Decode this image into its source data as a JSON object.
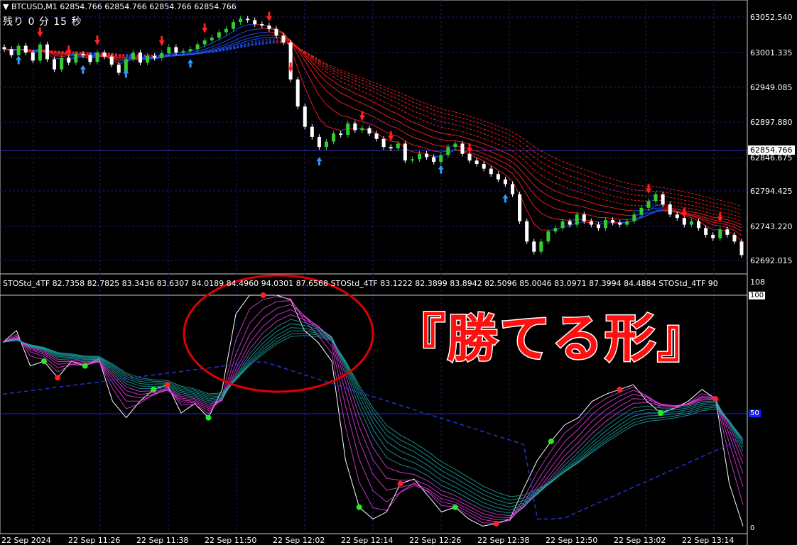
{
  "header": {
    "symbol_line": "BTCUSD,M1  62854.766 62854.766 62854.766 62854.766",
    "timer": "残り 0 分 15 秒"
  },
  "price_axis": [
    "63052.540",
    "63001.335",
    "62949.085",
    "62897.880",
    "62846.675",
    "62794.425",
    "62743.220",
    "62692.015"
  ],
  "current_price": "62854.766",
  "indicator": {
    "header": "STOStd_4TF 82.7358 82.7825 83.3436 83.6307 84.0189 84.4960 94.0301 87.6568  STOStd_4TF 83.1222 82.3899 83.8942 82.5096 85.0046 83.0971 87.3994 84.4884  STOStd_4TF 90",
    "top_label": "108",
    "level_100": "100",
    "level_50": "50",
    "level_0": "0"
  },
  "time_axis": [
    "22 Sep 2024",
    "22 Sep 11:26",
    "22 Sep 11:38",
    "22 Sep 11:50",
    "22 Sep 12:02",
    "22 Sep 12:14",
    "22 Sep 12:26",
    "22 Sep 12:38",
    "22 Sep 12:50",
    "22 Sep 13:02",
    "22 Sep 13:14"
  ],
  "annotation": "『勝てる形』",
  "colors": {
    "up_candle": "#33cc33",
    "down_candle": "#ffffff",
    "ribbon_red": "#ff2222",
    "ribbon_blue": "#2255ff",
    "osc_magenta": "#ee44ee",
    "osc_teal": "#22aaaa",
    "circle": "#e00000"
  },
  "chart_data": {
    "type": "candlestick",
    "close": [
      63005,
      62996,
      63010,
      63000,
      62988,
      63012,
      62990,
      62975,
      62992,
      62985,
      62998,
      62996,
      62986,
      63000,
      62994,
      62982,
      62970,
      62990,
      63000,
      62985,
      62995,
      62992,
      62999,
      63008,
      63000,
      63002,
      63005,
      63012,
      63018,
      63022,
      63030,
      63035,
      63045,
      63050,
      63048,
      63042,
      63040,
      63035,
      63025,
      63015,
      62960,
      62920,
      62890,
      62875,
      62860,
      62868,
      62880,
      62878,
      62895,
      62885,
      62888,
      62880,
      62872,
      62860,
      62858,
      62865,
      62840,
      62842,
      62850,
      62845,
      62838,
      62848,
      62860,
      62865,
      62850,
      62840,
      62835,
      62828,
      62820,
      62812,
      62805,
      62790,
      62750,
      62720,
      62705,
      62720,
      62735,
      62740,
      62750,
      62745,
      62760,
      62750,
      62745,
      62740,
      62752,
      62748,
      62745,
      62750,
      62760,
      62770,
      62780,
      62790,
      62775,
      62760,
      62755,
      62745,
      62750,
      62740,
      62730,
      62725,
      62738,
      62730,
      62720,
      62700
    ],
    "indicator_sample": [
      80,
      85,
      70,
      72,
      65,
      72,
      70,
      73,
      55,
      48,
      55,
      60,
      62,
      50,
      54,
      48,
      60,
      92,
      100,
      100,
      100,
      98,
      85,
      80,
      72,
      30,
      10,
      5,
      8,
      20,
      22,
      15,
      8,
      10,
      5,
      2,
      3,
      5,
      18,
      30,
      38,
      45,
      48,
      55,
      58,
      60,
      62,
      55,
      50,
      52,
      55,
      60,
      56,
      20,
      2
    ]
  }
}
